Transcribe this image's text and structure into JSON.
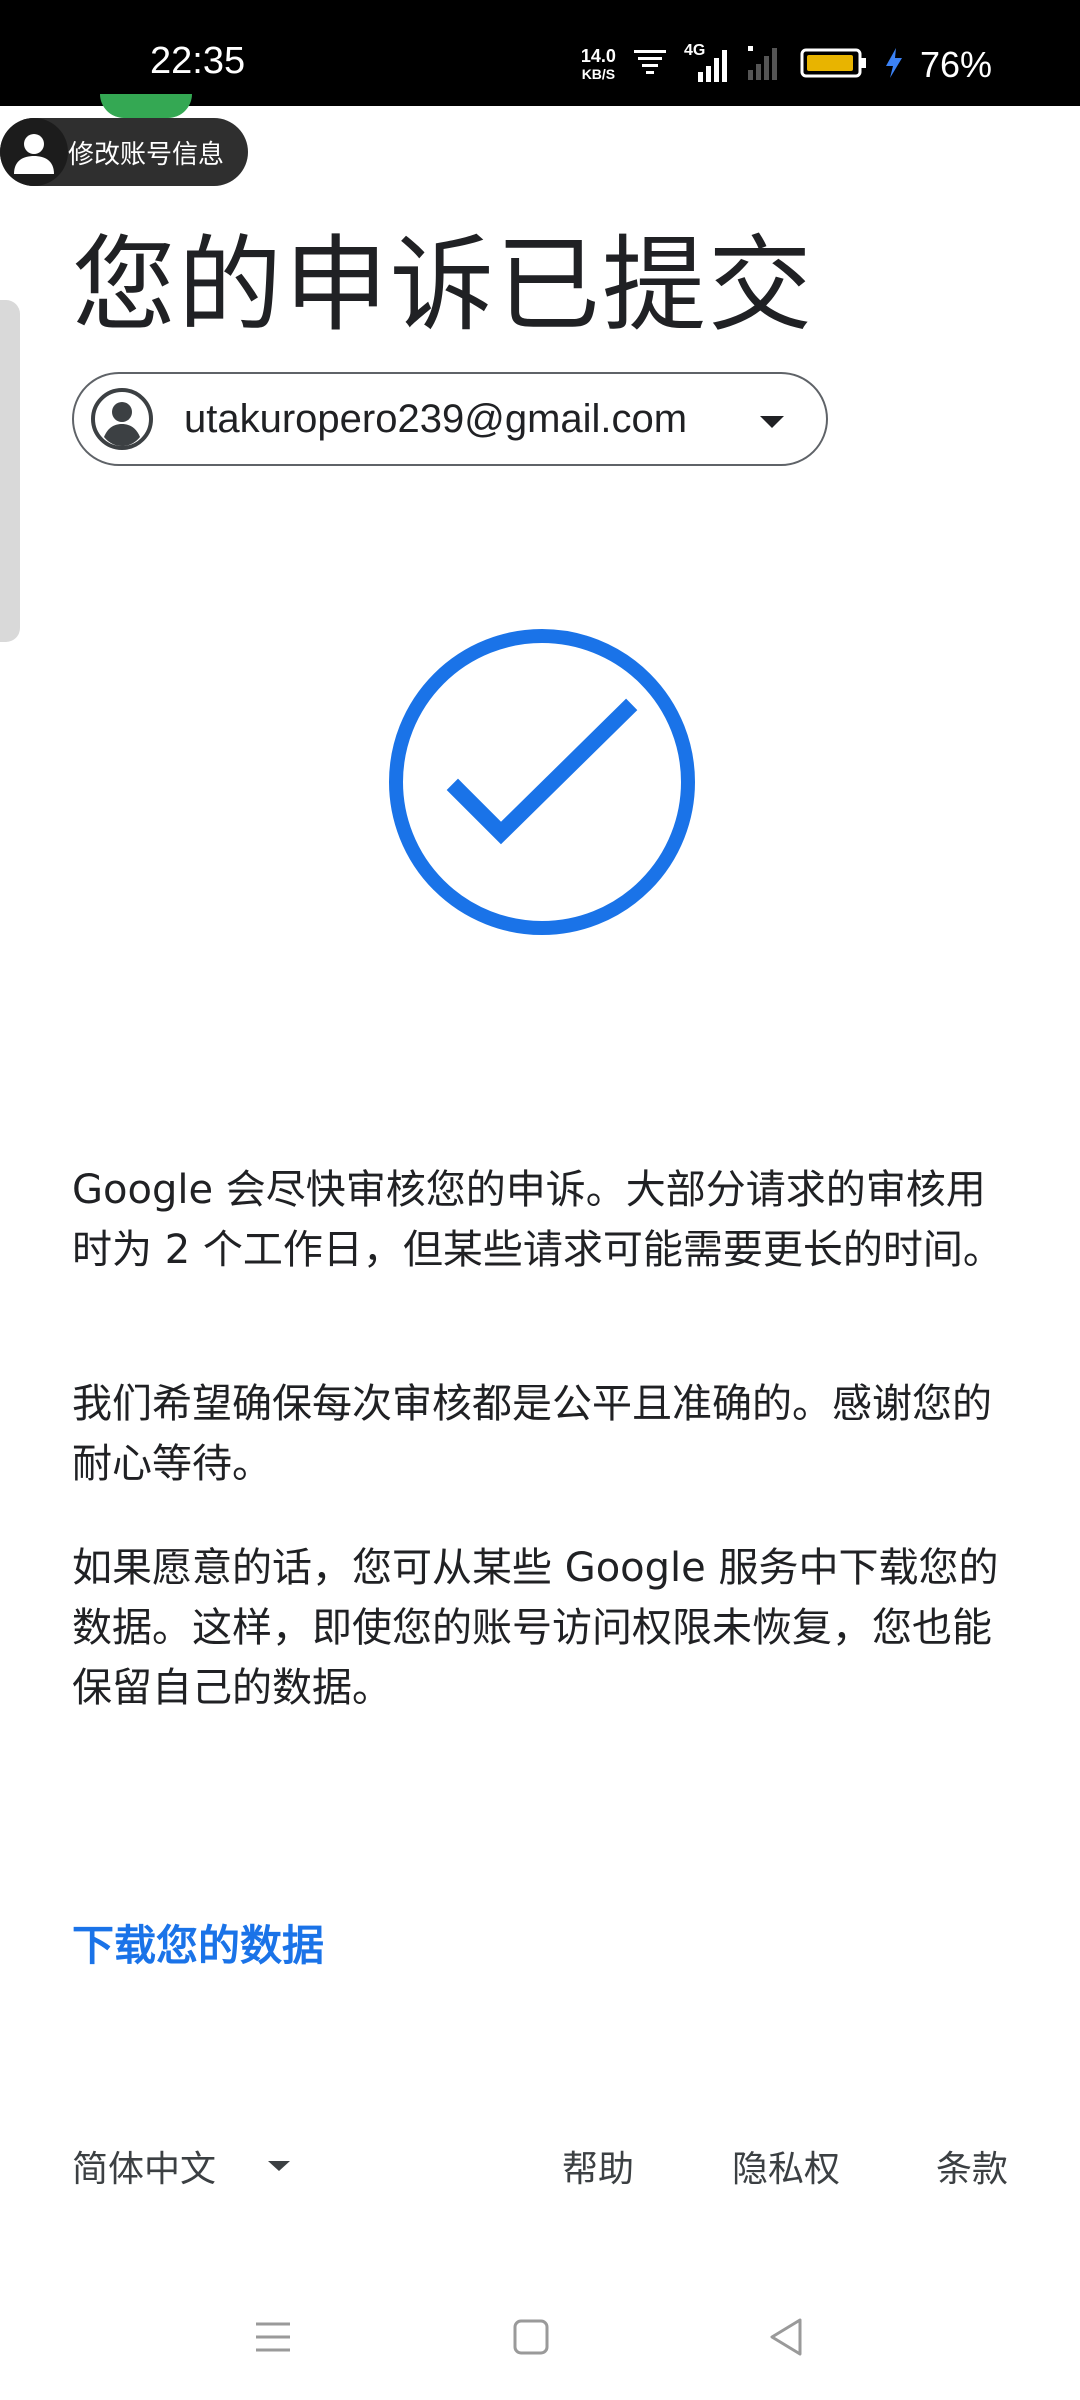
{
  "status_bar": {
    "time": "22:35",
    "net_speed_value": "14.0",
    "net_speed_unit": "KB/S",
    "network_type": "4G",
    "battery_percent": "76%",
    "icons": [
      "wifi-icon",
      "signal-4g-icon",
      "signal-icon",
      "battery-icon",
      "charging-bolt-icon"
    ]
  },
  "floating_button": {
    "label": "修改账号信息",
    "icon": "user-icon"
  },
  "page": {
    "title": "您的申诉已提交",
    "account_email": "utakuropero239@gmail.com",
    "account_icon": "account-circle-icon",
    "success_icon": "check-circle-icon",
    "paragraphs": [
      "Google 会尽快审核您的申诉。大部分请求的审核用时为 2 个工作日，但某些请求可能需要更长的时间。",
      "我们希望确保每次审核都是公平且准确的。感谢您的耐心等待。",
      "如果愿意的话，您可从某些 Google 服务中下载您的数据。这样，即使您的账号访问权限未恢复，您也能保留自己的数据。"
    ],
    "download_link": "下载您的数据"
  },
  "footer": {
    "language": "简体中文",
    "help": "帮助",
    "privacy": "隐私权",
    "terms": "条款"
  },
  "colors": {
    "accent": "#1a73e8",
    "text": "#202124",
    "battery_fill": "#e8b400"
  }
}
